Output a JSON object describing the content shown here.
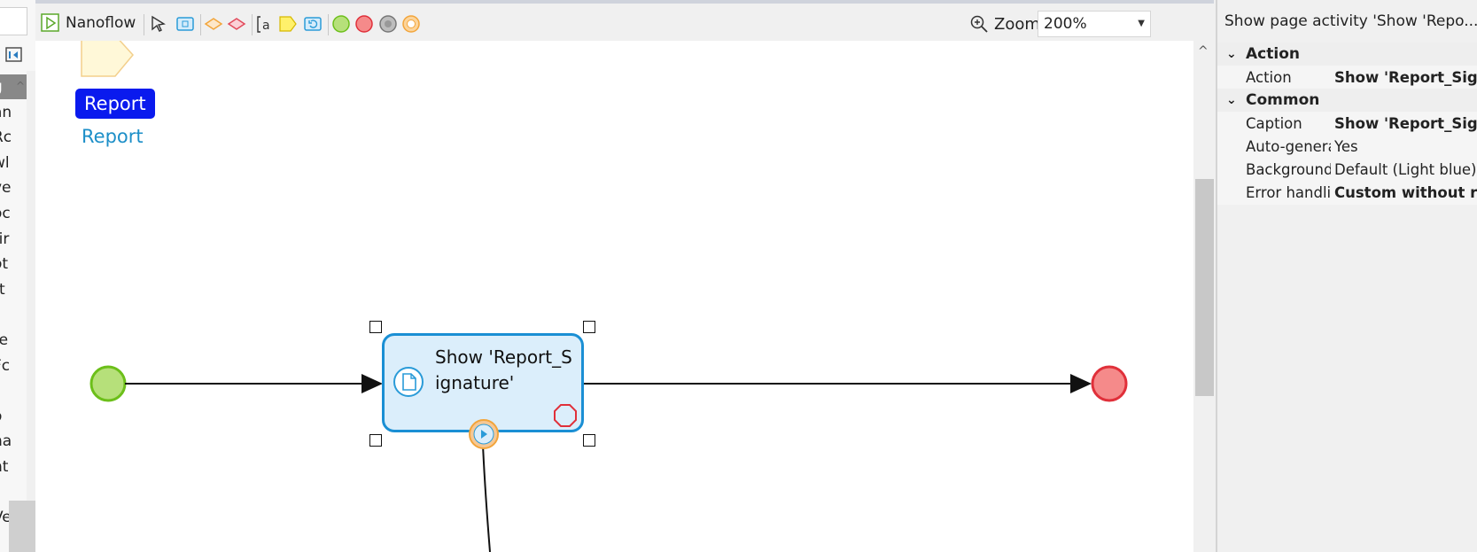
{
  "left_panel": {
    "rows": [
      {
        "text": "g",
        "selected": true
      },
      {
        "text": "an"
      },
      {
        "text": "Rc"
      },
      {
        "text": "wl"
      },
      {
        "text": "ve"
      },
      {
        "text": "oc"
      },
      {
        "text": "tir"
      },
      {
        "text": "ot"
      },
      {
        "text": "rt"
      },
      {
        "text": ""
      },
      {
        "text": "re"
      },
      {
        "text": "Fc"
      },
      {
        "text": ""
      },
      {
        "text": "o"
      },
      {
        "text": "na"
      },
      {
        "text": "nt"
      },
      {
        "text": ""
      },
      {
        "text": "Ve"
      }
    ]
  },
  "toolbar": {
    "nanoflow_label": "Nanoflow",
    "zoom_label": "Zoom",
    "zoom_value": "200%"
  },
  "canvas": {
    "annotation_label": "Report",
    "annotation_caption": "Report",
    "activity_text": "Show 'Report_Signature'"
  },
  "properties": {
    "title": "Show page activity 'Show 'Repo...",
    "categories": [
      {
        "name": "Action",
        "rows": [
          {
            "key": "Action",
            "value": "Show 'Report_Sig",
            "bold": true
          }
        ]
      },
      {
        "name": "Common",
        "rows": [
          {
            "key": "Caption",
            "value": "Show 'Report_Sig",
            "bold": true
          },
          {
            "key": "Auto-genera",
            "value": "Yes",
            "bold": false
          },
          {
            "key": "Background",
            "value": "Default (Light blue)",
            "bold": false
          },
          {
            "key": "Error handlin",
            "value": "Custom without r",
            "bold": true
          }
        ]
      }
    ]
  },
  "colors": {
    "start_event": "#b6e07a",
    "end_event": "#f58a8a",
    "activity_border": "#1a8fd4",
    "label_bg": "#0a1aee"
  }
}
